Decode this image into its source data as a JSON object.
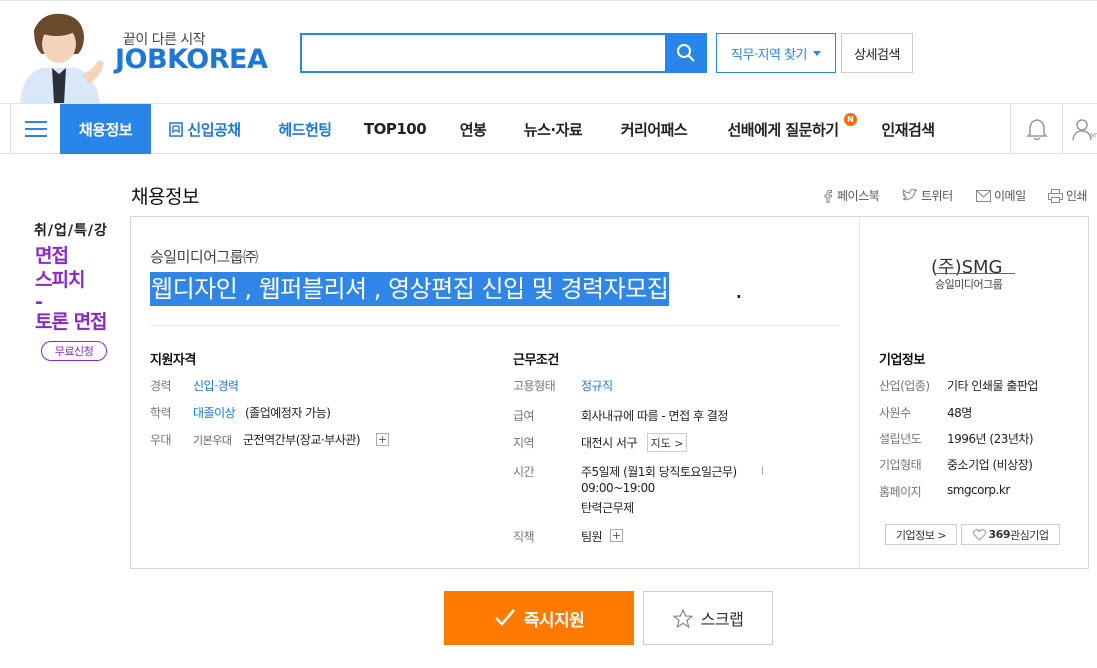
{
  "header": {
    "tagline": "끝이 다른 시작",
    "logo": "JOBKOREA",
    "search": {
      "placeholder": "",
      "value": ""
    },
    "area_button": "직무·지역 찾기",
    "detail_search": "상세검색"
  },
  "nav": {
    "items": [
      {
        "label": "채용정보"
      },
      {
        "label": "신입공채"
      },
      {
        "label": "헤드헌팅"
      },
      {
        "label": "TOP100"
      },
      {
        "label": "연봉"
      },
      {
        "label": "뉴스·자료"
      },
      {
        "label": "커리어패스"
      },
      {
        "label": "선배에게 질문하기"
      },
      {
        "label": "인재검색"
      }
    ],
    "new_badge": "N",
    "my_label": "MY"
  },
  "promo": {
    "small": "취/업/특/강",
    "line1": "면접",
    "line2": "스피치",
    "line3": "-",
    "line4": "토론 면접",
    "button": "무료신청"
  },
  "page": {
    "title": "채용정보",
    "share": {
      "facebook": "페이스북",
      "twitter": "트위터",
      "email": "이메일",
      "print": "인쇄"
    }
  },
  "job": {
    "company": "승일미디어그룹㈜",
    "title": "웹디자인 , 웹퍼블리셔 , 영상편집 신입 및 경력자모집",
    "title_tail": ".",
    "qualification": {
      "heading": "지원자격",
      "career_label": "경력",
      "career_value": "신입·경력",
      "edu_label": "학력",
      "edu_value": "대졸이상",
      "edu_note": "(졸업예정자 가능)",
      "pref_label": "우대",
      "pref_sub": "기본우대",
      "pref_value": "군전역간부(장교·부사관)",
      "plus": "+"
    },
    "conditions": {
      "heading": "근무조건",
      "type_label": "고용형태",
      "type_value": "정규직",
      "salary_label": "급여",
      "salary_value": "회사내규에 따름 - 면접 후 결정",
      "region_label": "지역",
      "region_value": "대전시 서구",
      "map_button": "지도 >",
      "time_label": "시간",
      "time_value1": "주5일제 (월1회 당직토요일근무)",
      "time_value2": "09:00~19:00",
      "time_value3": "탄력근무제",
      "role_label": "직책",
      "role_value": "팀원",
      "plus": "+"
    }
  },
  "company": {
    "logo_text": "(주)SMG",
    "logo_sub": "승일미디어그룹",
    "heading": "기업정보",
    "industry_label": "산업(업종)",
    "industry_value": "기타 인쇄물 출판업",
    "employees_label": "사원수",
    "employees_value": "48명",
    "founded_label": "설립년도",
    "founded_value": "1996년 (23년차)",
    "corp_type_label": "기업형태",
    "corp_type_value": "중소기업 (비상장)",
    "homepage_label": "홈페이지",
    "homepage_value": "smgcorp.kr",
    "info_button": "기업정보 >",
    "interest_count": "369",
    "interest_label": "관심기업"
  },
  "actions": {
    "apply": "즉시지원",
    "scrap": "스크랩"
  },
  "colors": {
    "brand_blue": "#2a85e8",
    "apply_orange": "#ff7a00",
    "promo_purple": "#8a2ac8"
  }
}
